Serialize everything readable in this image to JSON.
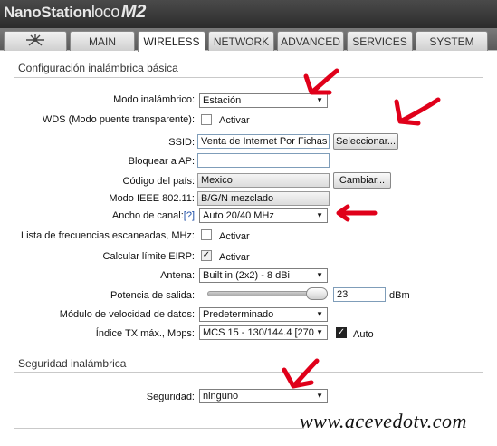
{
  "brand": {
    "name": "NanoStation",
    "model": "loco",
    "version": "M2"
  },
  "tabs": [
    {
      "label": "",
      "icon": "ubiquiti-logo-icon"
    },
    {
      "label": "MAIN"
    },
    {
      "label": "WIRELESS",
      "active": true
    },
    {
      "label": "NETWORK"
    },
    {
      "label": "ADVANCED"
    },
    {
      "label": "SERVICES"
    },
    {
      "label": "SYSTEM"
    }
  ],
  "basic": {
    "title": "Configuración inalámbrica básica",
    "mode": {
      "label": "Modo inalámbrico:",
      "value": "Estación"
    },
    "wds": {
      "label": "WDS (Modo puente transparente):",
      "check_label": "Activar",
      "checked": false
    },
    "ssid": {
      "label": "SSID:",
      "value": "Venta de Internet Por Fichas",
      "button": "Seleccionar..."
    },
    "lock_ap": {
      "label": "Bloquear a AP:",
      "value": ""
    },
    "country": {
      "label": "Código del país:",
      "value": "Mexico",
      "button": "Cambiar..."
    },
    "ieee": {
      "label": "Modo IEEE 802.11:",
      "value": "B/G/N mezclado"
    },
    "channel_width": {
      "label": "Ancho de canal:",
      "help": "[?]",
      "value": "Auto 20/40 MHz"
    },
    "scan_list": {
      "label": "Lista de frecuencias escaneadas, MHz:",
      "check_label": "Activar",
      "checked": false
    },
    "eirp": {
      "label": "Calcular límite EIRP:",
      "check_label": "Activar",
      "checked": true
    },
    "antenna": {
      "label": "Antena:",
      "value": "Built in (2x2) - 8 dBi"
    },
    "power": {
      "label": "Potencia de salida:",
      "value": "23",
      "unit": "dBm"
    },
    "data_rate": {
      "label": "Módulo de velocidad de datos:",
      "value": "Predeterminado"
    },
    "tx_index": {
      "label": "Índice TX máx., Mbps:",
      "value": "MCS 15 - 130/144.4 [270",
      "check_label": "Auto",
      "checked": true
    }
  },
  "security": {
    "title": "Seguridad inalámbrica",
    "security": {
      "label": "Seguridad:",
      "value": "ninguno"
    }
  },
  "watermark": "www.acevedotv.com",
  "colors": {
    "annotation_red": "#e0001a"
  }
}
